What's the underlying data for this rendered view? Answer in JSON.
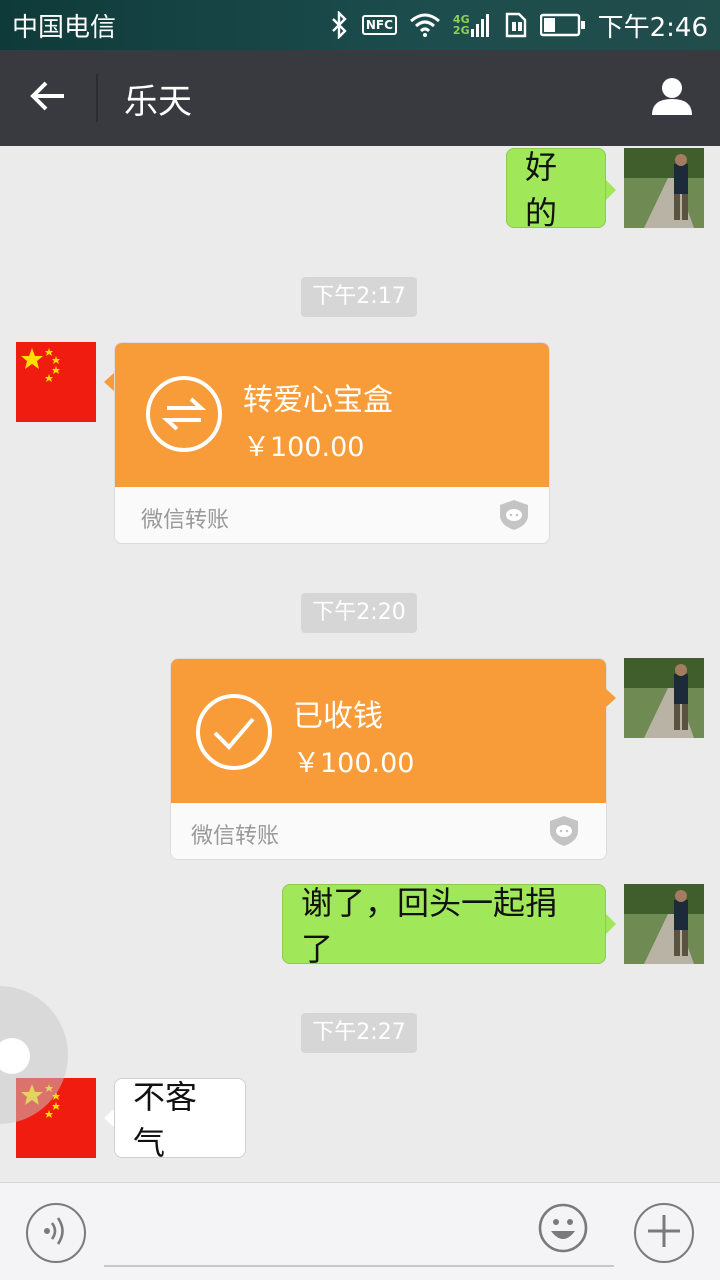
{
  "status_bar": {
    "carrier": "中国电信",
    "nfc": "NFC",
    "net_top": "4G",
    "net_bottom": "2G",
    "time": "下午2:46"
  },
  "header": {
    "title": "乐天"
  },
  "messages": [
    {
      "side": "right",
      "type": "text",
      "text": "好的"
    },
    {
      "type": "timestamp",
      "text": "下午2:17"
    },
    {
      "side": "left",
      "type": "transfer",
      "title": "转爱心宝盒",
      "amount": "￥100.00",
      "footer": "微信转账"
    },
    {
      "type": "timestamp",
      "text": "下午2:20"
    },
    {
      "side": "right",
      "type": "transfer",
      "title": "已收钱",
      "amount": "￥100.00",
      "footer": "微信转账"
    },
    {
      "side": "right",
      "type": "text",
      "text": "谢了，回头一起捐了"
    },
    {
      "type": "timestamp",
      "text": "下午2:27"
    },
    {
      "side": "left",
      "type": "text",
      "text": "不客气"
    }
  ],
  "colors": {
    "titlebar": "#393a3f",
    "green_bubble": "#a0e75a",
    "transfer_orange": "#f79c39",
    "chat_bg": "#ebebeb"
  },
  "icons": {
    "back": "back-arrow-icon",
    "profile": "person-icon",
    "voice": "voice-icon",
    "emoji": "emoji-icon",
    "more": "plus-icon",
    "transfer": "transfer-arrows-icon",
    "received": "check-circle-icon",
    "wechat_shield": "wechat-shield-icon"
  }
}
